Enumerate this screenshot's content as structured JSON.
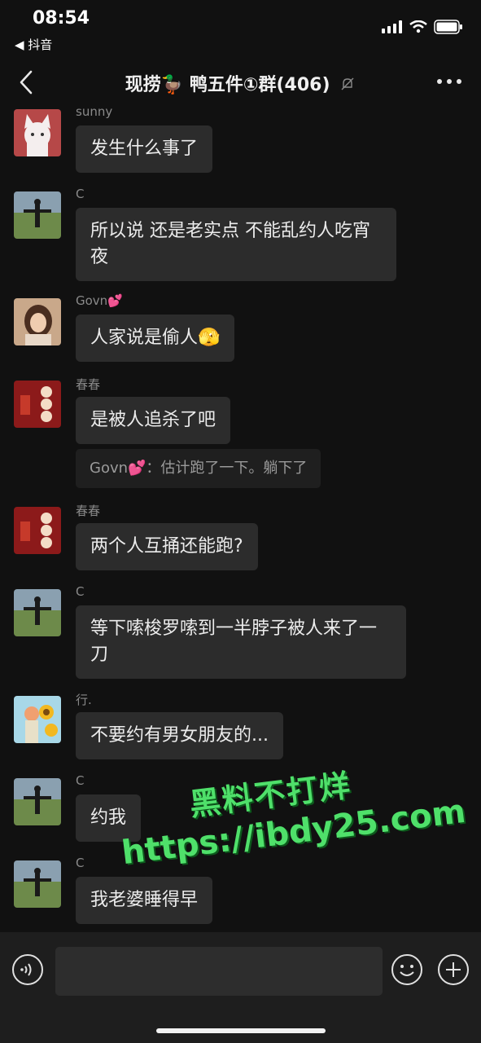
{
  "status_bar": {
    "time": "08:54",
    "back_app": "◀ 抖音"
  },
  "header": {
    "title": "现捞🦆 鸭五件①群(406)"
  },
  "messages": [
    {
      "sender": "sunny",
      "text": "发生什么事了",
      "avatar": "cartoon-girl"
    },
    {
      "sender": "C",
      "text": "所以说 还是老实点 不能乱约人吃宵夜",
      "avatar": "man-field"
    },
    {
      "sender": "Govn💕",
      "text": "人家说是偷人🫣",
      "avatar": "girl-photo"
    },
    {
      "sender": "春春",
      "text": "是被人追杀了吧",
      "avatar": "new-year-red",
      "quote": "Govn💕：估计跑了一下。躺下了"
    },
    {
      "sender": "春春",
      "text": "两个人互捅还能跑?",
      "avatar": "new-year-red"
    },
    {
      "sender": "C",
      "text": "等下嗦梭罗嗦到一半脖子被人来了一刀",
      "avatar": "man-field"
    },
    {
      "sender": "行.",
      "text": "不要约有男女朋友的...",
      "avatar": "sunflower-kid"
    },
    {
      "sender": "C",
      "text": "约我",
      "avatar": "man-field"
    },
    {
      "sender": "C",
      "text": "我老婆睡得早",
      "avatar": "man-field"
    }
  ],
  "watermark": {
    "line1": "黑料不打烊",
    "line2": "https://ibdy25.com"
  },
  "input_bar": {
    "placeholder": ""
  },
  "colors": {
    "background": "#111111",
    "bubble": "#2c2c2c",
    "watermark": "#4fe06a"
  }
}
